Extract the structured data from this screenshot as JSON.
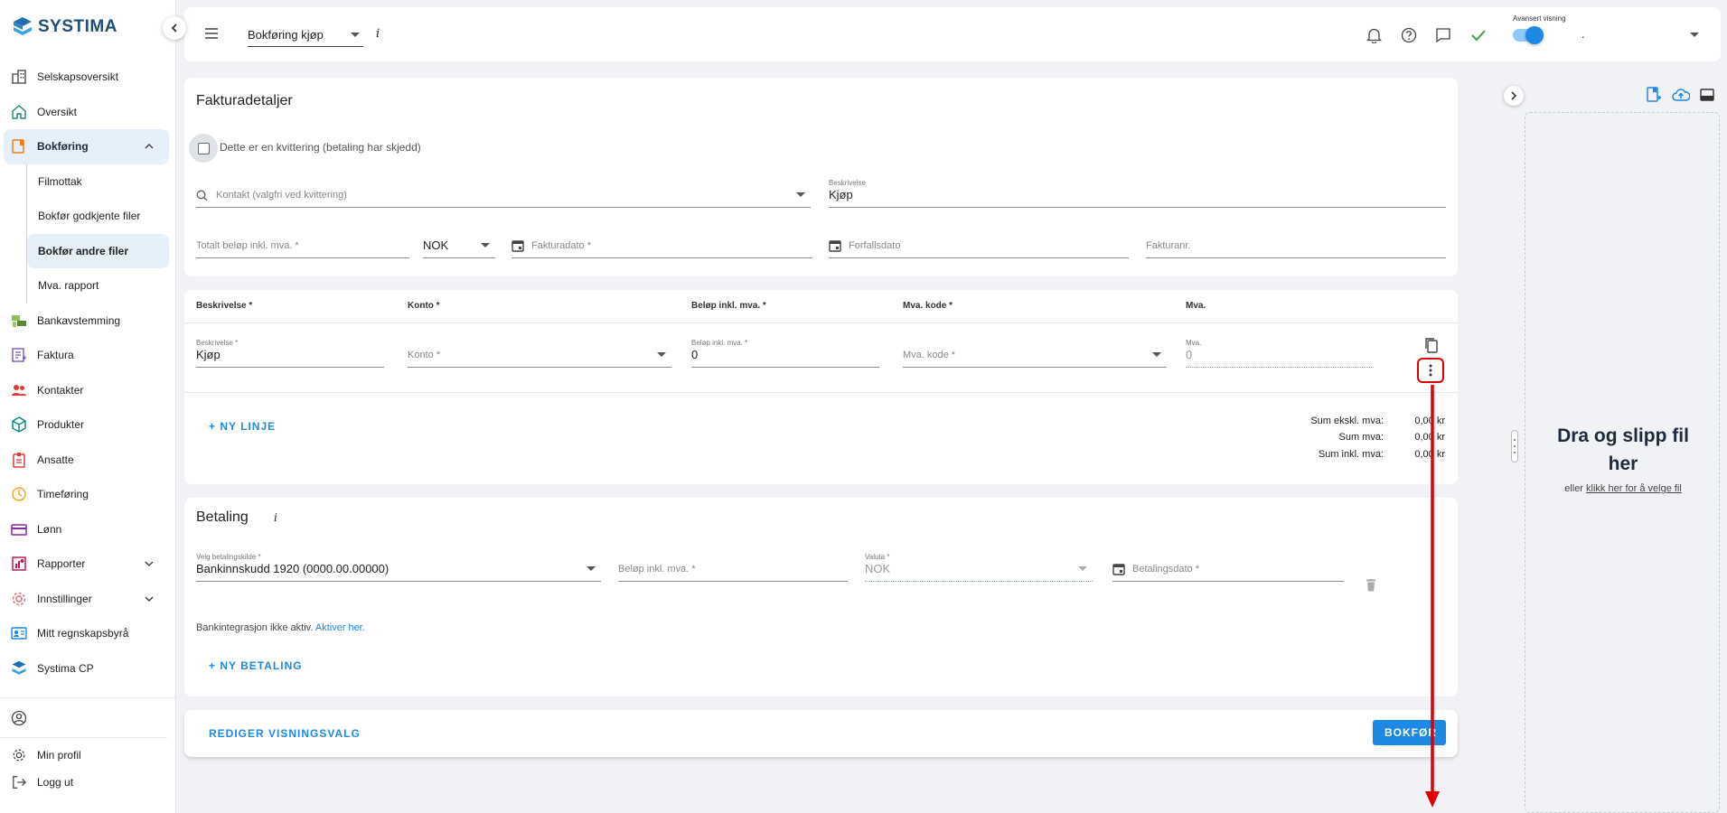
{
  "app": {
    "brand": "SYSTIMA",
    "brand_color": "#1f6fb2"
  },
  "sidebar": {
    "items": [
      {
        "label": "Selskapsoversikt",
        "icon": "building-icon"
      },
      {
        "label": "Oversikt",
        "icon": "home-icon"
      },
      {
        "label": "Bokføring",
        "icon": "bookkeeping-icon",
        "expanded": true
      },
      {
        "label": "Bankavstemming",
        "icon": "bank-icon"
      },
      {
        "label": "Faktura",
        "icon": "invoice-icon"
      },
      {
        "label": "Kontakter",
        "icon": "contacts-icon"
      },
      {
        "label": "Produkter",
        "icon": "box-icon"
      },
      {
        "label": "Ansatte",
        "icon": "badge-icon"
      },
      {
        "label": "Timeføring",
        "icon": "clock-icon"
      },
      {
        "label": "Lønn",
        "icon": "card-icon"
      },
      {
        "label": "Rapporter",
        "icon": "reports-icon"
      },
      {
        "label": "Innstillinger",
        "icon": "gear-icon"
      },
      {
        "label": "Mitt regnskapsbyrå",
        "icon": "id-card-icon"
      },
      {
        "label": "Systima CP",
        "icon": "systima-icon"
      }
    ],
    "subitems": [
      "Filmottak",
      "Bokfør godkjente filer",
      "Bokfør andre filer",
      "Mva. rapport"
    ],
    "bottom": {
      "profile": "Min profil",
      "logout": "Logg ut"
    }
  },
  "topbar": {
    "page_select": "Bokføring kjøp",
    "info": "i",
    "toggle_label": "Avansert visning",
    "user_select": "."
  },
  "invoice": {
    "title": "Fakturadetaljer",
    "receipt_checkbox": "Dette er en kvittering (betaling har skjedd)",
    "contact_placeholder": "Kontakt (valgfri ved kvittering)",
    "description_label": "Beskrivelse",
    "description_value": "Kjøp",
    "total_placeholder": "Totalt beløp inkl. mva. *",
    "currency": "NOK",
    "invoice_date_placeholder": "Fakturadato *",
    "due_date_placeholder": "Forfallsdato",
    "invoice_no_placeholder": "Fakturanr."
  },
  "lines": {
    "headers": [
      "Beskrivelse *",
      "Konto *",
      "Beløp inkl. mva. *",
      "Mva. kode *",
      "Mva."
    ],
    "row": {
      "desc_label": "Beskrivelse *",
      "desc_value": "Kjøp",
      "account_placeholder": "Konto *",
      "amount_label": "Beløp inkl. mva. *",
      "amount_value": "0",
      "vat_code_placeholder": "Mva. kode *",
      "vat_label": "Mva.",
      "vat_value": "0"
    },
    "new_line": "+ NY LINJE",
    "sums": [
      {
        "label": "Sum ekskl. mva:",
        "value": "0,00 kr"
      },
      {
        "label": "Sum mva:",
        "value": "0,00 kr"
      },
      {
        "label": "Sum inkl. mva:",
        "value": "0,00 kr"
      }
    ]
  },
  "payment": {
    "title": "Betaling",
    "info": "i",
    "source_label": "Velg betalingskilde *",
    "source_value": "Bankinnskudd 1920 (0000.00.00000)",
    "amount_placeholder": "Beløp inkl. mva. *",
    "currency_label": "Valuta *",
    "currency_value": "NOK",
    "date_placeholder": "Betalingsdato *",
    "bank_note": "Bankintegrasjon ikke aktiv.",
    "bank_link": "Aktiver her.",
    "new_payment": "+ NY BETALING"
  },
  "footer": {
    "edit_view": "REDIGER VISNINGSVALG",
    "submit": "BOKFØR"
  },
  "dropzone": {
    "title": "Dra og slipp fil her",
    "or": "eller",
    "link": "klikk her for å velge fil"
  },
  "colors": {
    "accent": "#1e88e5",
    "highlight": "#e00000",
    "active_bg": "#e6f0fb"
  }
}
